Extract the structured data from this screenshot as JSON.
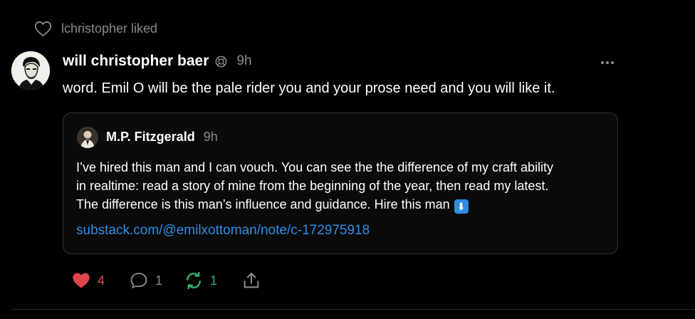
{
  "liked": {
    "text": "lchristopher liked"
  },
  "post": {
    "author": "will christopher baer",
    "time": "9h",
    "body": "word. Emil O will be the pale rider you and your prose need and you will like it."
  },
  "quote": {
    "author": "M.P. Fitzgerald",
    "time": "9h",
    "lines": [
      "I’ve hired this man and I can vouch. You can see the the difference of my craft ability",
      "in realtime: read a story of mine from the beginning of the year, then read my latest.",
      "The difference is this man’s influence and guidance. Hire this man"
    ],
    "emoji": "⬇",
    "link": "substack.com/@emilxottoman/note/c-172975918"
  },
  "actions": {
    "likes": "4",
    "comments": "1",
    "restacks": "1"
  },
  "icons": {
    "liked": "heart-outline-icon",
    "badge": "badge-icon",
    "more": "more-horizontal-icon",
    "like": "heart-filled-icon",
    "comment": "comment-icon",
    "restack": "restack-icon",
    "share": "share-icon"
  },
  "colors": {
    "background": "#000000",
    "muted": "#8a8a8a",
    "like": "#e0454e",
    "restack": "#2fb36b",
    "link": "#2f8de4"
  }
}
